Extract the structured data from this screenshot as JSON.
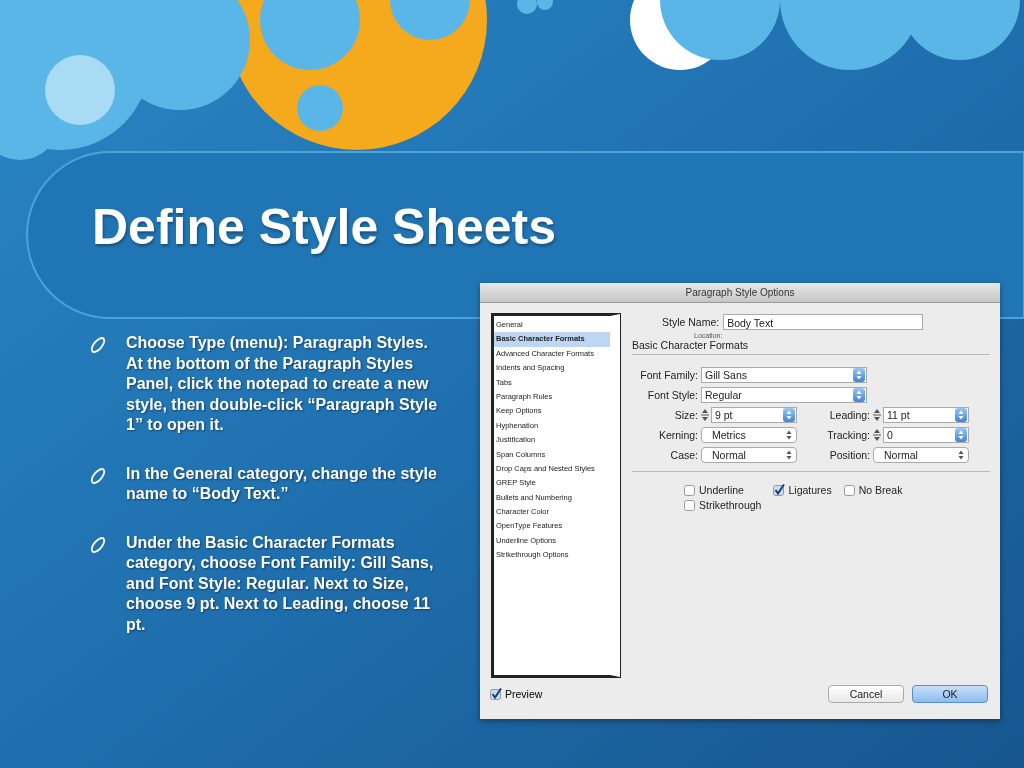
{
  "slide": {
    "title": "Define Style Sheets",
    "bullets": [
      "Choose Type (menu): Paragraph Styles. At the bottom of the Paragraph Styles Panel, click the notepad to create a new style, then double-click “Paragraph Style 1” to open it.",
      "In the General category, change the style name to “Body Text.”",
      "Under the Basic Character Formats category, choose Font Family: Gill Sans, and Font Style: Regular. Next to Size, choose 9 pt. Next to Leading, choose 11 pt."
    ]
  },
  "dialog": {
    "title": "Paragraph Style Options",
    "categories": [
      {
        "label": "General",
        "selected": false
      },
      {
        "label": "Basic Character Formats",
        "selected": true
      },
      {
        "label": "Advanced Character Formats",
        "selected": false
      },
      {
        "label": "Indents and Spacing",
        "selected": false
      },
      {
        "label": "Tabs",
        "selected": false
      },
      {
        "label": "Paragraph Rules",
        "selected": false
      },
      {
        "label": "Keep Options",
        "selected": false
      },
      {
        "label": "Hyphenation",
        "selected": false
      },
      {
        "label": "Justification",
        "selected": false
      },
      {
        "label": "Span Columns",
        "selected": false
      },
      {
        "label": "Drop Caps and Nested Styles",
        "selected": false
      },
      {
        "label": "GREP Style",
        "selected": false
      },
      {
        "label": "Bullets and Numbering",
        "selected": false
      },
      {
        "label": "Character Color",
        "selected": false
      },
      {
        "label": "OpenType Features",
        "selected": false
      },
      {
        "label": "Underline Options",
        "selected": false
      },
      {
        "label": "Strikethrough Options",
        "selected": false
      }
    ],
    "style_name": {
      "label": "Style Name:",
      "value": "Body Text"
    },
    "location_label": "Location:",
    "section_title": "Basic Character Formats",
    "wide_fields": [
      {
        "label": "Font Family:",
        "value": "Gill Sans"
      },
      {
        "label": "Font Style:",
        "value": "Regular"
      }
    ],
    "grid_fields": [
      {
        "kind": "stepper",
        "label": "Size:",
        "value": "9 pt"
      },
      {
        "kind": "stepper",
        "label": "Leading:",
        "value": "11 pt"
      },
      {
        "kind": "popup",
        "label": "Kerning:",
        "value": "Metrics"
      },
      {
        "kind": "stepper",
        "label": "Tracking:",
        "value": "0"
      },
      {
        "kind": "popup",
        "label": "Case:",
        "value": "Normal"
      },
      {
        "kind": "popup",
        "label": "Position:",
        "value": "Normal"
      }
    ],
    "checkboxes": [
      {
        "label": "Underline",
        "checked": false
      },
      {
        "label": "Ligatures",
        "checked": true
      },
      {
        "label": "No Break",
        "checked": false
      },
      {
        "label": "Strikethrough",
        "checked": false
      }
    ],
    "preview": {
      "label": "Preview",
      "checked": true
    },
    "buttons": [
      {
        "label": "Cancel",
        "kind": "normal"
      },
      {
        "label": "OK",
        "kind": "default"
      }
    ]
  }
}
